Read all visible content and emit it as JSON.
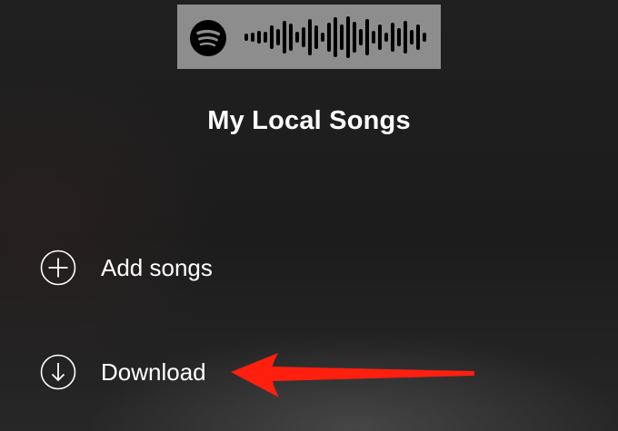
{
  "spotify_code": {
    "logo_icon": "spotify-logo-icon",
    "wave_icon": "soundwave-code-icon"
  },
  "playlist": {
    "title": "My Local Songs"
  },
  "actions": {
    "add": {
      "icon": "plus-circle-icon",
      "label": "Add songs"
    },
    "download": {
      "icon": "download-circle-icon",
      "label": "Download"
    }
  },
  "colors": {
    "background": "#1e1e1e",
    "text": "#ffffff",
    "code_background": "#8d8d8d",
    "annotation_arrow": "#ff1f0f"
  }
}
